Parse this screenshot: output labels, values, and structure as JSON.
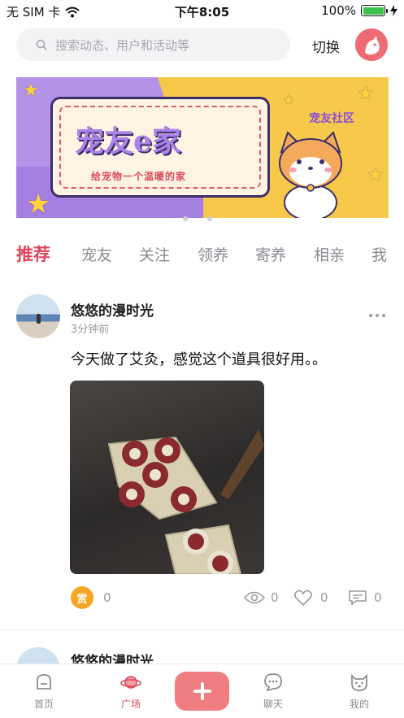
{
  "status_bar": {
    "carrier": "无 SIM 卡",
    "time": "下午8:05",
    "battery": "100%",
    "battery_level": 1.0
  },
  "header": {
    "search_placeholder": "搜索动态、用户和活动等",
    "switch_label": "切换"
  },
  "banner": {
    "title": "宠友e家",
    "subtitle": "给宠物一个温暖的家",
    "tag": "宠友社区",
    "page_count": 2,
    "active_page": 1
  },
  "tabs": [
    {
      "label": "推荐",
      "active": true
    },
    {
      "label": "宠友",
      "active": false
    },
    {
      "label": "关注",
      "active": false
    },
    {
      "label": "领养",
      "active": false
    },
    {
      "label": "寄养",
      "active": false
    },
    {
      "label": "相亲",
      "active": false
    },
    {
      "label": "我",
      "active": false
    }
  ],
  "posts": [
    {
      "user": "悠悠的漫时光",
      "time": "3分钟前",
      "text": "今天做了艾灸，感觉这个道具很好用。。",
      "reward_label": "赏",
      "reward_count": "0",
      "views": "0",
      "likes": "0",
      "comments": "0"
    },
    {
      "user": "悠悠的漫时光"
    }
  ],
  "bottom_nav": {
    "items": [
      {
        "label": "首页",
        "icon": "home-icon"
      },
      {
        "label": "广场",
        "icon": "planet-icon",
        "active": true
      },
      {
        "label": "",
        "icon": "plus-icon"
      },
      {
        "label": "聊天",
        "icon": "chat-icon"
      },
      {
        "label": "我的",
        "icon": "dog-face-icon"
      }
    ]
  },
  "colors": {
    "accent": "#e0455c",
    "plus_button": "#f07d80",
    "reward": "#f5a623"
  }
}
